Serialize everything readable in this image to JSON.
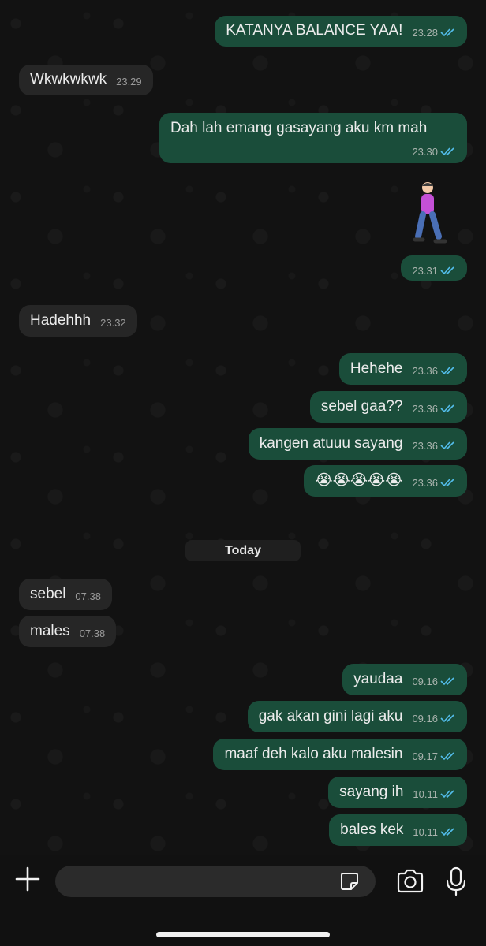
{
  "messages": [
    {
      "id": "m1",
      "dir": "out",
      "text": "KATANYA BALANCE YAA!",
      "time": "23.28"
    },
    {
      "id": "m2",
      "dir": "in",
      "text": "Wkwkwkwk",
      "time": "23.29"
    },
    {
      "id": "m3",
      "dir": "out",
      "text": "Dah lah emang gasayang aku km mah",
      "time": "23.30"
    },
    {
      "id": "m4",
      "dir": "out",
      "text": "",
      "time": "23.31",
      "sticker": "person-walking-emoji"
    },
    {
      "id": "m5",
      "dir": "in",
      "text": "Hadehhh",
      "time": "23.32"
    },
    {
      "id": "m6",
      "dir": "out",
      "text": "Hehehe",
      "time": "23.36"
    },
    {
      "id": "m7",
      "dir": "out",
      "text": "sebel gaa??",
      "time": "23.36"
    },
    {
      "id": "m8",
      "dir": "out",
      "text": "kangen atuuu sayang",
      "time": "23.36"
    },
    {
      "id": "m9",
      "dir": "out",
      "text": "😭😭😭😭😭",
      "time": "23.36"
    },
    {
      "id": "m10",
      "dir": "in",
      "text": "sebel",
      "time": "07.38"
    },
    {
      "id": "m11",
      "dir": "in",
      "text": "males",
      "time": "07.38"
    },
    {
      "id": "m12",
      "dir": "out",
      "text": "yaudaa",
      "time": "09.16"
    },
    {
      "id": "m13",
      "dir": "out",
      "text": "gak akan gini lagi aku",
      "time": "09.16"
    },
    {
      "id": "m14",
      "dir": "out",
      "text": "maaf deh kalo aku malesin",
      "time": "09.17"
    },
    {
      "id": "m15",
      "dir": "out",
      "text": "sayang ih",
      "time": "10.11"
    },
    {
      "id": "m16",
      "dir": "out",
      "text": "bales kek",
      "time": "10.11"
    }
  ],
  "day_separator": "Today",
  "composer": {
    "placeholder": "",
    "icons": [
      "plus-icon",
      "sticker-icon",
      "camera-icon",
      "microphone-icon"
    ]
  },
  "colors": {
    "outgoing_bubble": "#1a4d3a",
    "incoming_bubble": "#262626",
    "read_ticks": "#53bdeb"
  }
}
